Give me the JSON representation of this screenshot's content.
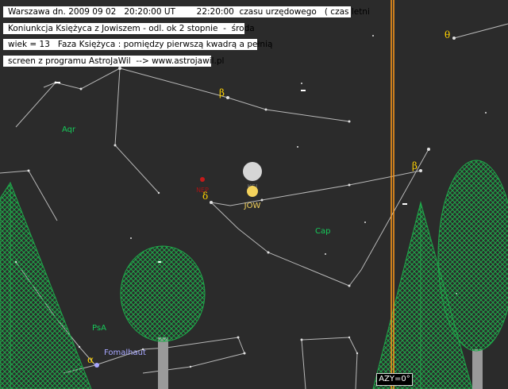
{
  "info_lines": [
    "Warszawa dn. 2009 09 02   20:20:00 UT        22:20:00  czasu urzędowego   ( czas letni",
    "Koniunkcja Księżyca z Jowiszem - odl. ok 2 stopnie  -  środa",
    "wiek = 13   Faza Księżyca : pomiędzy pierwszą kwadrą a pełnią",
    "screen z programu AstroJaWil  --> www.astrojawil.pl"
  ],
  "labels": {
    "aqr": "Aqr",
    "cap": "Cap",
    "psa": "PsA",
    "fomalhaut": "Fomalhaut",
    "jupiter": "JOW",
    "moon_symbol": "KSI",
    "neptune": "NEP",
    "beta_left": "β",
    "beta_right": "β",
    "theta": "θ",
    "delta": "δ",
    "alpha": "α"
  },
  "azimuth": "AZY=0°",
  "colors": {
    "sky": "#2b2b2b",
    "lines": "#b8b8b8",
    "constellation_label": "#17c95a",
    "greek": "#ffd200",
    "meridian": "#ff9a1a",
    "tree": "#1fa84a",
    "trunk": "#9a9a9a",
    "moon": "#d6d6d6",
    "jupiter": "#f3d25c",
    "neptune": "#c41a1a",
    "fomalhaut": "#a7a7ff"
  }
}
